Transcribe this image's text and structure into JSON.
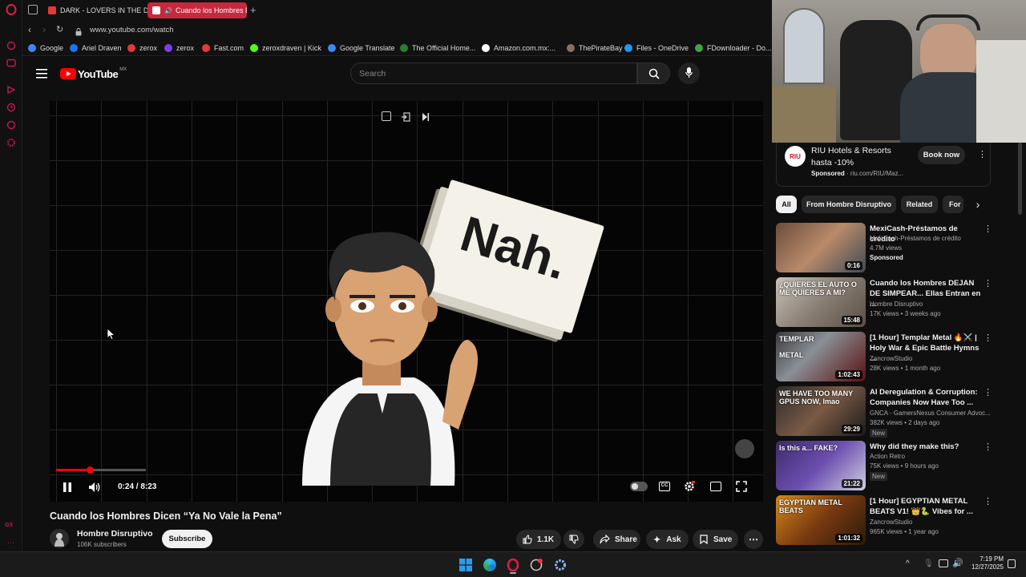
{
  "browser": {
    "tabs": [
      {
        "label": "DARK - LOVERS IN THE DA"
      },
      {
        "label": "Cuando los Hombres D"
      }
    ],
    "url": "www.youtube.com/watch",
    "bookmarks": [
      {
        "label": "Google",
        "color": "#4285f4"
      },
      {
        "label": "Ariel Draven",
        "color": "#1877f2"
      },
      {
        "label": "zerox",
        "color": "#e53935"
      },
      {
        "label": "zerox",
        "color": "#7b3fe4"
      },
      {
        "label": "Fast.com",
        "color": "#e53935"
      },
      {
        "label": "zeroxdraven | Kick",
        "color": "#53fc18"
      },
      {
        "label": "Google Translate",
        "color": "#4285f4"
      },
      {
        "label": "The Official Home...",
        "color": "#2e7d32"
      },
      {
        "label": "Amazon.com.mx:...",
        "color": "#ffffff"
      },
      {
        "label": "ThePirateBay",
        "color": "#8d6e63"
      },
      {
        "label": "Files - OneDrive",
        "color": "#2196f3"
      },
      {
        "label": "FDownloader - Do...",
        "color": "#43a047"
      }
    ]
  },
  "youtube": {
    "logo_text": "YouTube",
    "region": "MX",
    "search_placeholder": "Search"
  },
  "player": {
    "time": "0:24 / 8:23",
    "progress": 0.048,
    "card_text": "Nah."
  },
  "video": {
    "title": "Cuando los Hombres Dicen “Ya No Vale la Pena”",
    "channel": "Hombre Disruptivo",
    "subscribers": "106K subscribers",
    "subscribe_label": "Subscribe",
    "likes": "1.1K",
    "share_label": "Share",
    "ask_label": "Ask",
    "save_label": "Save"
  },
  "ad": {
    "title_line1": "RIU Hotels & Resorts",
    "title_line2": "hasta -10%",
    "sponsored": "Sponsored",
    "domain": "riu.com/RIU/Maz...",
    "cta": "Book now",
    "logo": "RIU"
  },
  "chips": [
    {
      "label": "All"
    },
    {
      "label": "From Hombre Disruptivo"
    },
    {
      "label": "Related"
    },
    {
      "label": "For"
    }
  ],
  "recommendations": [
    {
      "title": "MexiCash-Préstamos de crédito",
      "channel": "MexiCash-Préstamos de crédito",
      "meta": "4.7M views",
      "badge": "Sponsored",
      "duration": "0:16"
    },
    {
      "title": "Cuando los Hombres DEJAN DE SIMPEAR... Ellas Entran en ...",
      "channel": "Hombre Disruptivo",
      "meta": "17K views • 3 weeks ago",
      "badge": "",
      "duration": "15:48"
    },
    {
      "title": "[1 Hour] Templar Metal 🔥⚔️ | Holy War & Epic Battle Hymns ...",
      "channel": "ZancrowStudio",
      "meta": "28K views • 1 month ago",
      "badge": "",
      "duration": "1:02:43"
    },
    {
      "title": "AI Deregulation & Corruption: Companies Now Have Too ...",
      "channel": "GNCA - GamersNexus Consumer Advoc...",
      "meta": "382K views • 2 days ago",
      "badge": "New",
      "duration": "29:29"
    },
    {
      "title": "Why did they make this?",
      "channel": "Action Retro",
      "meta": "75K views • 9 hours ago",
      "badge": "New",
      "duration": "21:22"
    },
    {
      "title": "[1 Hour] EGYPTIAN METAL BEATS V1! 👑🐍 Vibes for ...",
      "channel": "ZancrowStudio",
      "meta": "965K views • 1 year ago",
      "badge": "",
      "duration": "1:01:32"
    }
  ],
  "thumb_text": {
    "t2a": "¿QUIERES EL AUTO O ME QUIERES A MI?",
    "t3a": "TEMPLAR",
    "t3b": "METAL",
    "t4a": "WE HAVE TOO MANY GPUS NOW, lmao",
    "t5a": "Is this a... FAKE?",
    "t6a": "EGYPTIAN METAL BEATS"
  },
  "sidebar_bottom": "GX",
  "taskbar": {
    "time": "7:19 PM",
    "date": "12/27/2025"
  }
}
